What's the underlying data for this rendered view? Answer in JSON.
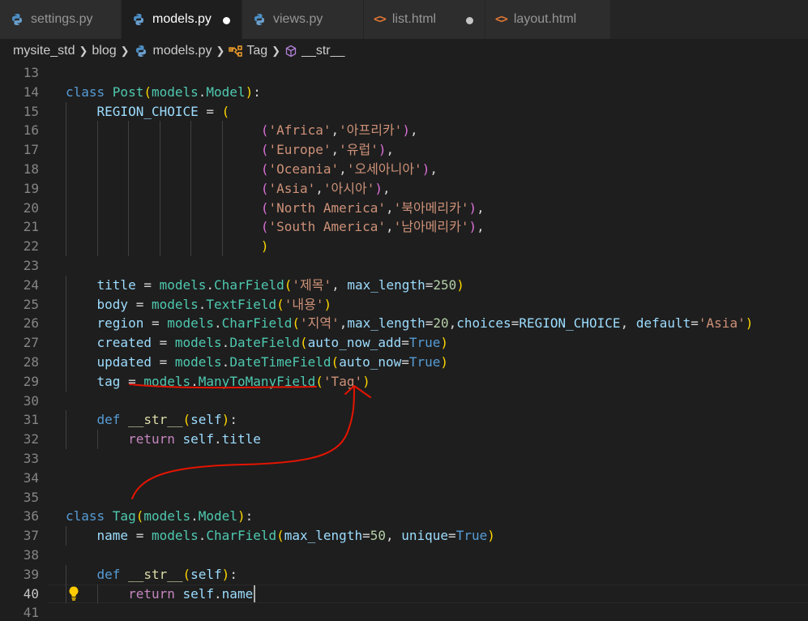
{
  "tabs": [
    {
      "label": "settings.py",
      "type": "python",
      "active": false,
      "modified": false
    },
    {
      "label": "models.py",
      "type": "python",
      "active": true,
      "modified": true
    },
    {
      "label": "views.py",
      "type": "python",
      "active": false,
      "modified": false
    },
    {
      "label": "list.html",
      "type": "html",
      "active": false,
      "modified": true
    },
    {
      "label": "layout.html",
      "type": "html",
      "active": false,
      "modified": false
    }
  ],
  "breadcrumb": {
    "items": [
      "mysite_std",
      "blog",
      "models.py",
      "Tag",
      "__str__"
    ]
  },
  "editor": {
    "current_line": 40,
    "lines": [
      {
        "n": "13",
        "tokens": []
      },
      {
        "n": "14",
        "tokens": [
          [
            "kw",
            "class "
          ],
          [
            "cls",
            "Post"
          ],
          [
            "p1",
            "("
          ],
          [
            "cls",
            "models"
          ],
          [
            "op",
            "."
          ],
          [
            "cls",
            "Model"
          ],
          [
            "p1",
            ")"
          ],
          [
            "op",
            ":"
          ]
        ]
      },
      {
        "n": "15",
        "tokens": [
          [
            "op",
            "    "
          ],
          [
            "var",
            "REGION_CHOICE"
          ],
          [
            "op",
            " = "
          ],
          [
            "p1",
            "("
          ]
        ]
      },
      {
        "n": "16",
        "tokens": [
          [
            "op",
            "                         "
          ],
          [
            "p2",
            "("
          ],
          [
            "str",
            "'Africa'"
          ],
          [
            "op",
            ","
          ],
          [
            "str",
            "'아프리카'"
          ],
          [
            "p2",
            ")"
          ],
          [
            "op",
            ","
          ]
        ]
      },
      {
        "n": "17",
        "tokens": [
          [
            "op",
            "                         "
          ],
          [
            "p2",
            "("
          ],
          [
            "str",
            "'Europe'"
          ],
          [
            "op",
            ","
          ],
          [
            "str",
            "'유럽'"
          ],
          [
            "p2",
            ")"
          ],
          [
            "op",
            ","
          ]
        ]
      },
      {
        "n": "18",
        "tokens": [
          [
            "op",
            "                         "
          ],
          [
            "p2",
            "("
          ],
          [
            "str",
            "'Oceania'"
          ],
          [
            "op",
            ","
          ],
          [
            "str",
            "'오세아니아'"
          ],
          [
            "p2",
            ")"
          ],
          [
            "op",
            ","
          ]
        ]
      },
      {
        "n": "19",
        "tokens": [
          [
            "op",
            "                         "
          ],
          [
            "p2",
            "("
          ],
          [
            "str",
            "'Asia'"
          ],
          [
            "op",
            ","
          ],
          [
            "str",
            "'아시아'"
          ],
          [
            "p2",
            ")"
          ],
          [
            "op",
            ","
          ]
        ]
      },
      {
        "n": "20",
        "tokens": [
          [
            "op",
            "                         "
          ],
          [
            "p2",
            "("
          ],
          [
            "str",
            "'North America'"
          ],
          [
            "op",
            ","
          ],
          [
            "str",
            "'북아메리카'"
          ],
          [
            "p2",
            ")"
          ],
          [
            "op",
            ","
          ]
        ]
      },
      {
        "n": "21",
        "tokens": [
          [
            "op",
            "                         "
          ],
          [
            "p2",
            "("
          ],
          [
            "str",
            "'South America'"
          ],
          [
            "op",
            ","
          ],
          [
            "str",
            "'남아메리카'"
          ],
          [
            "p2",
            ")"
          ],
          [
            "op",
            ","
          ]
        ]
      },
      {
        "n": "22",
        "tokens": [
          [
            "op",
            "                         "
          ],
          [
            "p1",
            ")"
          ]
        ]
      },
      {
        "n": "23",
        "tokens": []
      },
      {
        "n": "24",
        "tokens": [
          [
            "op",
            "    "
          ],
          [
            "var",
            "title"
          ],
          [
            "op",
            " = "
          ],
          [
            "cls",
            "models"
          ],
          [
            "op",
            "."
          ],
          [
            "cls",
            "CharField"
          ],
          [
            "p1",
            "("
          ],
          [
            "str",
            "'제목'"
          ],
          [
            "op",
            ", "
          ],
          [
            "var",
            "max_length"
          ],
          [
            "op",
            "="
          ],
          [
            "num",
            "250"
          ],
          [
            "p1",
            ")"
          ]
        ]
      },
      {
        "n": "25",
        "tokens": [
          [
            "op",
            "    "
          ],
          [
            "var",
            "body"
          ],
          [
            "op",
            " = "
          ],
          [
            "cls",
            "models"
          ],
          [
            "op",
            "."
          ],
          [
            "cls",
            "TextField"
          ],
          [
            "p1",
            "("
          ],
          [
            "str",
            "'내용'"
          ],
          [
            "p1",
            ")"
          ]
        ]
      },
      {
        "n": "26",
        "tokens": [
          [
            "op",
            "    "
          ],
          [
            "var",
            "region"
          ],
          [
            "op",
            " = "
          ],
          [
            "cls",
            "models"
          ],
          [
            "op",
            "."
          ],
          [
            "cls",
            "CharField"
          ],
          [
            "p1",
            "("
          ],
          [
            "str",
            "'지역'"
          ],
          [
            "op",
            ","
          ],
          [
            "var",
            "max_length"
          ],
          [
            "op",
            "="
          ],
          [
            "num",
            "20"
          ],
          [
            "op",
            ","
          ],
          [
            "var",
            "choices"
          ],
          [
            "op",
            "="
          ],
          [
            "var",
            "REGION_CHOICE"
          ],
          [
            "op",
            ", "
          ],
          [
            "var",
            "default"
          ],
          [
            "op",
            "="
          ],
          [
            "str",
            "'Asia'"
          ],
          [
            "p1",
            ")"
          ]
        ]
      },
      {
        "n": "27",
        "tokens": [
          [
            "op",
            "    "
          ],
          [
            "var",
            "created"
          ],
          [
            "op",
            " = "
          ],
          [
            "cls",
            "models"
          ],
          [
            "op",
            "."
          ],
          [
            "cls",
            "DateField"
          ],
          [
            "p1",
            "("
          ],
          [
            "var",
            "auto_now_add"
          ],
          [
            "op",
            "="
          ],
          [
            "kw",
            "True"
          ],
          [
            "p1",
            ")"
          ]
        ]
      },
      {
        "n": "28",
        "tokens": [
          [
            "op",
            "    "
          ],
          [
            "var",
            "updated"
          ],
          [
            "op",
            " = "
          ],
          [
            "cls",
            "models"
          ],
          [
            "op",
            "."
          ],
          [
            "cls",
            "DateTimeField"
          ],
          [
            "p1",
            "("
          ],
          [
            "var",
            "auto_now"
          ],
          [
            "op",
            "="
          ],
          [
            "kw",
            "True"
          ],
          [
            "p1",
            ")"
          ]
        ]
      },
      {
        "n": "29",
        "tokens": [
          [
            "op",
            "    "
          ],
          [
            "var",
            "tag"
          ],
          [
            "op",
            " = "
          ],
          [
            "cls",
            "models"
          ],
          [
            "op",
            "."
          ],
          [
            "cls",
            "ManyToManyField"
          ],
          [
            "p1",
            "("
          ],
          [
            "str",
            "'Tag'"
          ],
          [
            "p1",
            ")"
          ]
        ]
      },
      {
        "n": "30",
        "tokens": []
      },
      {
        "n": "31",
        "tokens": [
          [
            "op",
            "    "
          ],
          [
            "kw",
            "def "
          ],
          [
            "fn",
            "__str__"
          ],
          [
            "p1",
            "("
          ],
          [
            "var",
            "self"
          ],
          [
            "p1",
            ")"
          ],
          [
            "op",
            ":"
          ]
        ]
      },
      {
        "n": "32",
        "tokens": [
          [
            "op",
            "        "
          ],
          [
            "kw2",
            "return "
          ],
          [
            "var",
            "self"
          ],
          [
            "op",
            "."
          ],
          [
            "var",
            "title"
          ]
        ]
      },
      {
        "n": "33",
        "tokens": []
      },
      {
        "n": "34",
        "tokens": []
      },
      {
        "n": "35",
        "tokens": []
      },
      {
        "n": "36",
        "tokens": [
          [
            "kw",
            "class "
          ],
          [
            "cls",
            "Tag"
          ],
          [
            "p1",
            "("
          ],
          [
            "cls",
            "models"
          ],
          [
            "op",
            "."
          ],
          [
            "cls",
            "Model"
          ],
          [
            "p1",
            ")"
          ],
          [
            "op",
            ":"
          ]
        ]
      },
      {
        "n": "37",
        "tokens": [
          [
            "op",
            "    "
          ],
          [
            "var",
            "name"
          ],
          [
            "op",
            " = "
          ],
          [
            "cls",
            "models"
          ],
          [
            "op",
            "."
          ],
          [
            "cls",
            "CharField"
          ],
          [
            "p1",
            "("
          ],
          [
            "var",
            "max_length"
          ],
          [
            "op",
            "="
          ],
          [
            "num",
            "50"
          ],
          [
            "op",
            ", "
          ],
          [
            "var",
            "unique"
          ],
          [
            "op",
            "="
          ],
          [
            "kw",
            "True"
          ],
          [
            "p1",
            ")"
          ]
        ]
      },
      {
        "n": "38",
        "tokens": []
      },
      {
        "n": "39",
        "tokens": [
          [
            "op",
            "    "
          ],
          [
            "kw",
            "def "
          ],
          [
            "fn",
            "__str__"
          ],
          [
            "p1",
            "("
          ],
          [
            "var",
            "self"
          ],
          [
            "p1",
            ")"
          ],
          [
            "op",
            ":"
          ]
        ]
      },
      {
        "n": "40",
        "tokens": [
          [
            "op",
            "        "
          ],
          [
            "kw2",
            "return "
          ],
          [
            "var",
            "self"
          ],
          [
            "op",
            "."
          ],
          [
            "var",
            "name"
          ]
        ]
      },
      {
        "n": "41",
        "tokens": []
      }
    ]
  },
  "colors": {
    "editor_bg": "#1e1e1e",
    "tab_bar_bg": "#252526",
    "keyword": "#569cd6",
    "class": "#4ec9b0",
    "variable": "#9cdcfe",
    "string": "#ce9178",
    "number": "#b5cea8",
    "function": "#dcdcaa",
    "control": "#c586c0",
    "annotation": "#e51400"
  },
  "icons": {
    "python": "python-file-icon",
    "html": "html-file-icon",
    "class_symbol": "class-symbol-icon",
    "method_symbol": "method-cube-icon",
    "lightbulb": "lightbulb-icon"
  }
}
